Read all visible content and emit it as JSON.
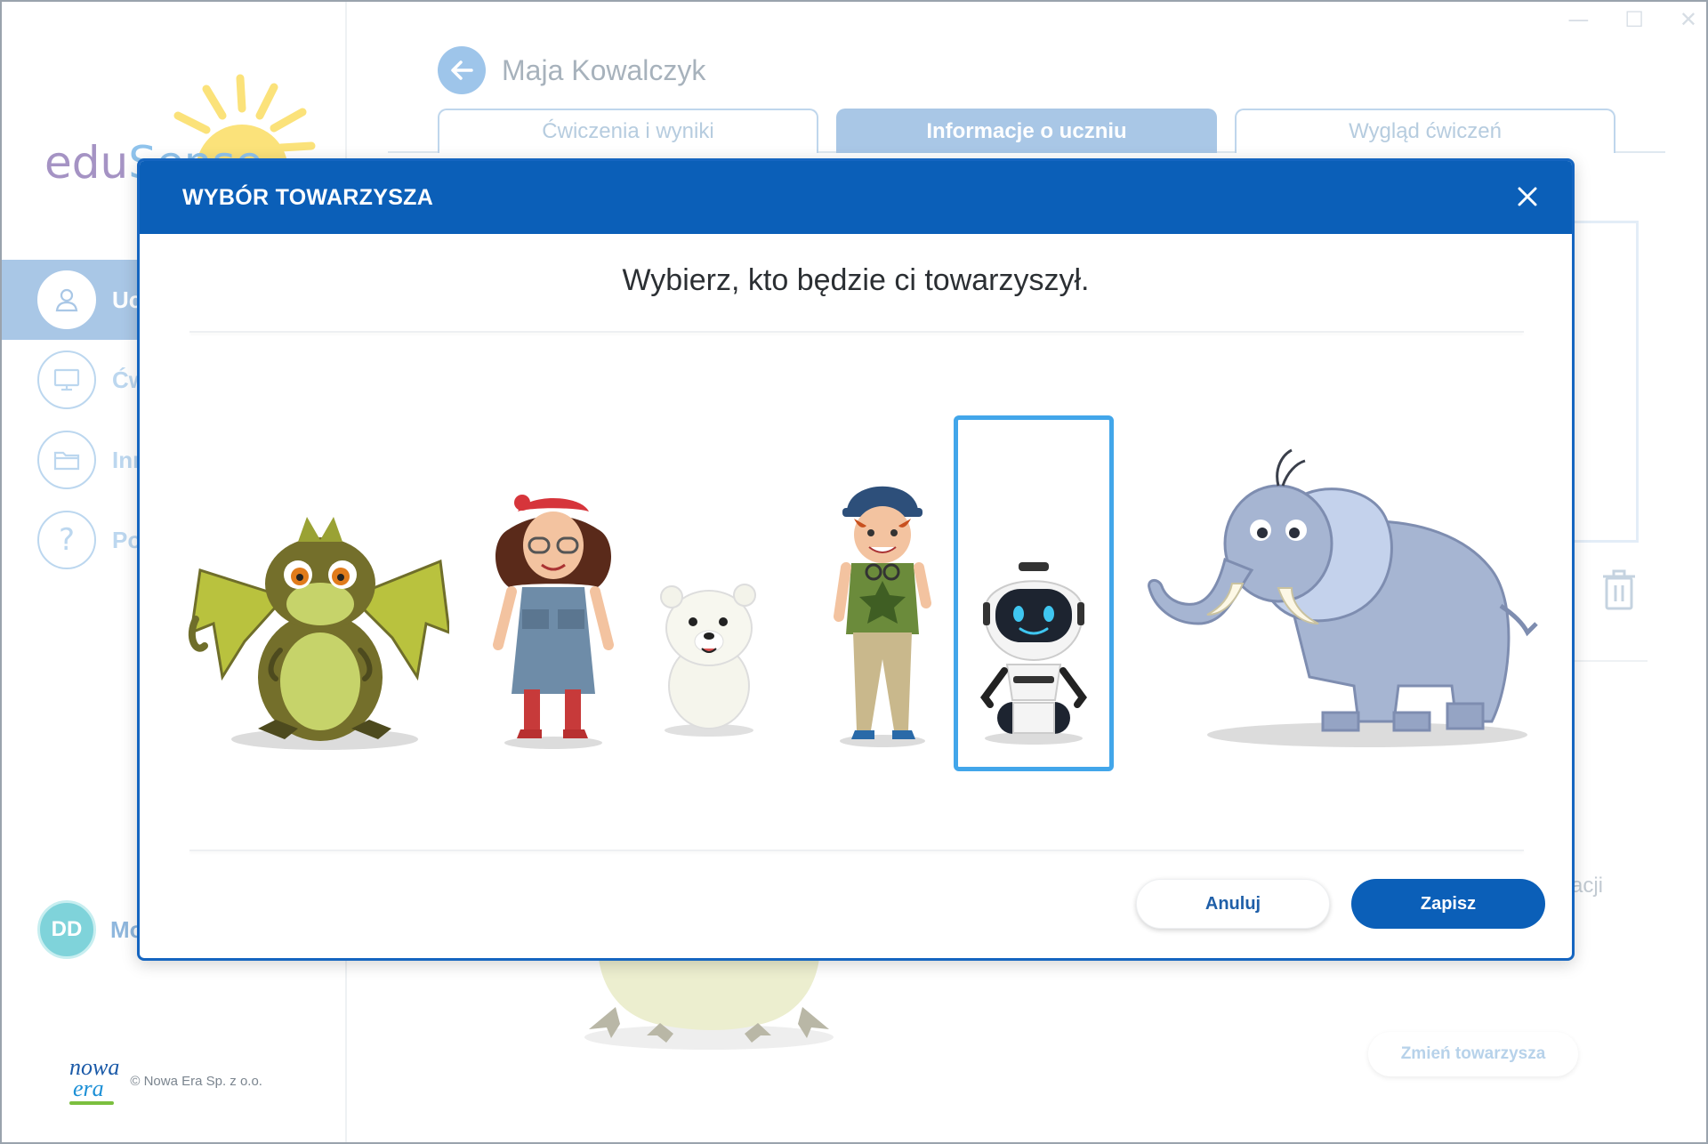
{
  "window": {
    "controls": [
      "—",
      "☐",
      "✕"
    ]
  },
  "sidebar": {
    "logo": {
      "part1": "edu",
      "part2": "Sense"
    },
    "items": [
      {
        "label": "Uczniowie",
        "icon": "user-icon",
        "active": true
      },
      {
        "label": "Ćwiczenia",
        "icon": "monitor-icon",
        "active": false
      },
      {
        "label": "Inne",
        "icon": "folder-icon",
        "active": false
      },
      {
        "label": "Pomoc",
        "icon": "question-icon",
        "active": false
      }
    ],
    "user": {
      "initials": "DD",
      "name": "Moje konto"
    },
    "footer": {
      "brand_line1": "nowa",
      "brand_line2": "era",
      "copyright": "© Nowa Era Sp. z o.o."
    }
  },
  "main": {
    "student_name": "Maja Kowalczyk",
    "tabs": [
      {
        "label": "Ćwiczenia i wyniki",
        "active": false
      },
      {
        "label": "Informacje o uczniu",
        "active": true
      },
      {
        "label": "Wygląd ćwiczeń",
        "active": false
      }
    ],
    "partial_text": "acji",
    "change_button": "Zmień towarzysza"
  },
  "modal": {
    "title": "WYBÓR TOWARZYSZA",
    "prompt": "Wybierz, kto będzie ci towarzyszył.",
    "companions": [
      {
        "id": "dragon",
        "selected": false
      },
      {
        "id": "girl",
        "selected": false
      },
      {
        "id": "polar-bear",
        "selected": false
      },
      {
        "id": "boy",
        "selected": false
      },
      {
        "id": "robot",
        "selected": true
      },
      {
        "id": "elephant",
        "selected": false
      }
    ],
    "cancel_label": "Anuluj",
    "save_label": "Zapisz"
  },
  "colors": {
    "modal_header": "#0b5fb8",
    "selection_border": "#42a6ea",
    "save_button": "#0b5fb8"
  }
}
